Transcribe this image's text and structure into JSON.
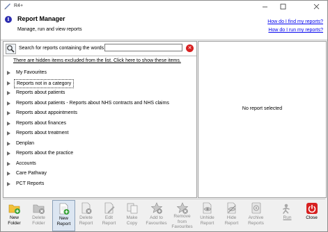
{
  "window": {
    "title": "R4+"
  },
  "header": {
    "title": "Report Manager",
    "subtitle": "Manage, run and view reports",
    "help_links": [
      "How do I find my reports?",
      "How do I run my reports?"
    ]
  },
  "search": {
    "label": "Search for reports containing the words",
    "value": "",
    "placeholder": ""
  },
  "hidden_note": "There are hidden items excluded from the list. Click here to show these items.",
  "tree": {
    "items": [
      {
        "label": "My Favourites"
      },
      {
        "label": "Reports not in a category",
        "selected": true
      },
      {
        "label": "Reports about patients"
      },
      {
        "label": "Reports about patients - Reports about NHS contracts and NHS claims"
      },
      {
        "label": "Reports about appointments"
      },
      {
        "label": "Reports about finances"
      },
      {
        "label": "Reports about treatment"
      },
      {
        "label": "Denplan"
      },
      {
        "label": "Reports about the practice"
      },
      {
        "label": "Accounts"
      },
      {
        "label": "Care Pathway"
      },
      {
        "label": "PCT Reports"
      }
    ]
  },
  "detail": {
    "empty_text": "No report selected"
  },
  "toolbar": {
    "buttons": [
      {
        "line1": "New",
        "line2": "Folder",
        "icon": "new-folder-icon",
        "enabled": true
      },
      {
        "line1": "Delete",
        "line2": "Folder",
        "icon": "delete-folder-icon",
        "enabled": false
      },
      {
        "line1": "New",
        "line2": "Report",
        "icon": "new-report-icon",
        "enabled": true
      },
      {
        "line1": "Delete",
        "line2": "Report",
        "icon": "delete-report-icon",
        "enabled": false
      },
      {
        "line1": "Edit",
        "line2": "Report",
        "icon": "edit-report-icon",
        "enabled": false
      },
      {
        "line1": "Make",
        "line2": "Copy",
        "icon": "copy-icon",
        "enabled": false
      },
      {
        "line1": "Add to",
        "line2": "Favourites",
        "icon": "add-favourite-icon",
        "enabled": false
      },
      {
        "line1": "Remove",
        "line2": "from",
        "line3": "Favourites",
        "icon": "remove-favourite-icon",
        "enabled": false
      },
      {
        "line1": "Unhide",
        "line2": "Report",
        "icon": "unhide-report-icon",
        "enabled": false
      },
      {
        "line1": "Hide",
        "line2": "Report",
        "icon": "hide-report-icon",
        "enabled": false
      },
      {
        "line1": "Archive",
        "line2": "Reports",
        "icon": "archive-reports-icon",
        "enabled": false
      },
      {
        "line1": "Run",
        "icon": "run-icon",
        "enabled": false
      },
      {
        "line1": "Close",
        "icon": "close-icon",
        "enabled": true
      }
    ]
  },
  "colors": {
    "link": "#0000ee",
    "close_red": "#d72020",
    "info_blue": "#2d2db0",
    "folder_yellow": "#f2c13a",
    "plus_green": "#3aa33a"
  }
}
